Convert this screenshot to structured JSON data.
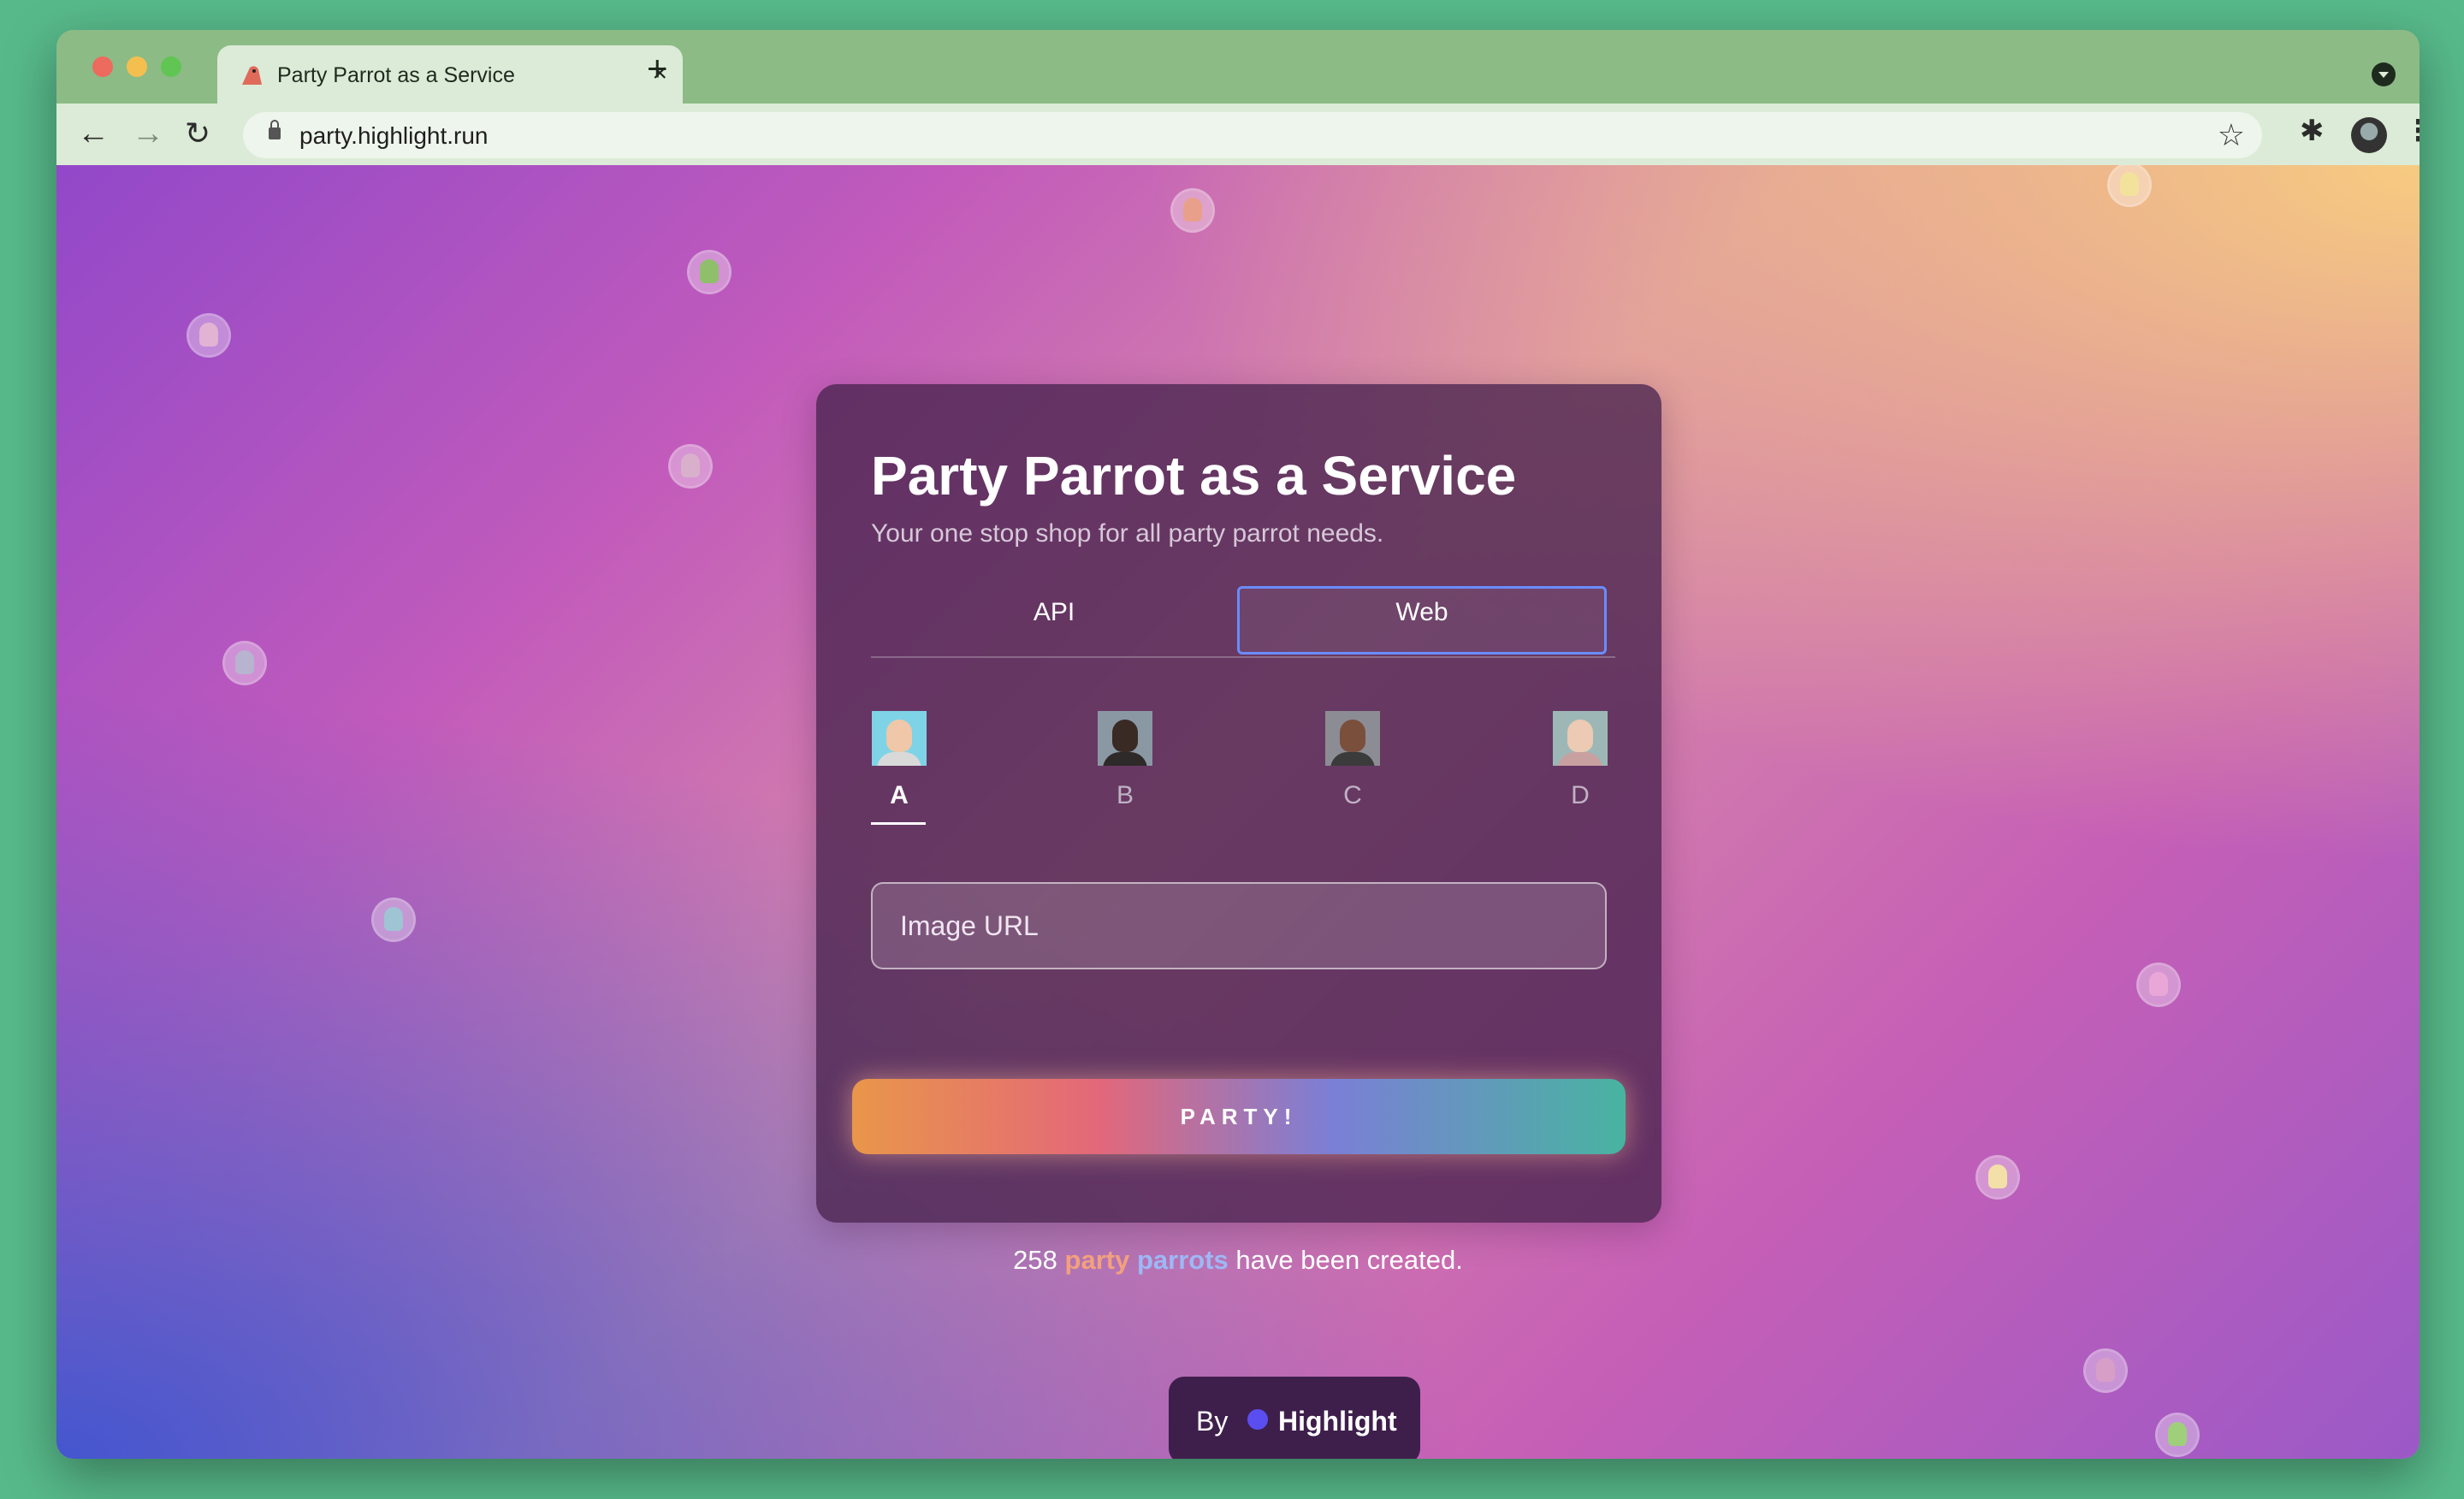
{
  "browser": {
    "tab_title": "Party Parrot as a Service",
    "tab_close": "×",
    "new_tab": "+",
    "url": "party.highlight.run",
    "back": "←",
    "forward": "→",
    "reload": "↻",
    "bookmark": "☆",
    "extensions": "✱",
    "menu": "⋮"
  },
  "card": {
    "title": "Party Parrot as a Service",
    "subtitle": "Your one stop shop for all party parrot needs.",
    "tabs": [
      {
        "label": "API",
        "selected": false
      },
      {
        "label": "Web",
        "selected": true
      }
    ],
    "avatars": [
      {
        "label": "A",
        "selected": true
      },
      {
        "label": "B",
        "selected": false
      },
      {
        "label": "C",
        "selected": false
      },
      {
        "label": "D",
        "selected": false
      }
    ],
    "image_url_placeholder": "Image URL",
    "image_url_value": "",
    "party_button": "PARTY!"
  },
  "counter": {
    "count": "258",
    "highlight_1": "party",
    "highlight_2": "parrots",
    "suffix": "have been created."
  },
  "byline": {
    "by": "By",
    "brand": "Highlight"
  },
  "colors": {
    "accent_border": "#6a8cff",
    "card_bg": "#48224e",
    "window_frame": "#8cbb86"
  }
}
